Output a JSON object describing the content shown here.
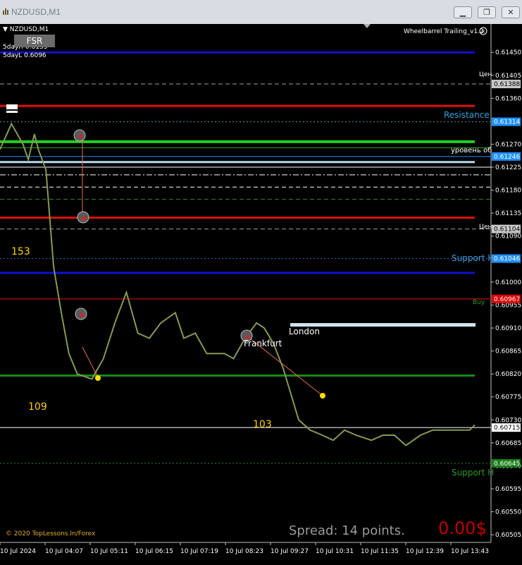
{
  "window": {
    "title": "NZDUSD,M1"
  },
  "chart_header": {
    "symbol": "NZDUSD,M1",
    "five_day_high": "5dayH 0.6153",
    "five_day_low": "5dayL 0.6096",
    "fsr_button": "FSR",
    "indicator_name": "Wheelbarrel Trailing_v1.2"
  },
  "overlay_labels": {
    "resistance": "Resistance",
    "support1": "Support H",
    "support2": "Support H",
    "level_ru": "уровень об",
    "cen1": "Цен",
    "cen2": "Цен",
    "buy": "Buy",
    "london": "London",
    "frankfurt": "Frankfurt",
    "num153": "153",
    "num109": "109",
    "num103": "103",
    "copyright": "© 2020 TopLessons.In/Forex",
    "spread": "Spread: 14 points.",
    "profit": "0.00$"
  },
  "price_axis": {
    "ticks": [
      "0.61450",
      "0.61405",
      "0.61360",
      "0.61270",
      "0.61225",
      "0.61180",
      "0.61135",
      "0.61090",
      "0.61000",
      "0.60955",
      "0.60910",
      "0.60865",
      "0.60820",
      "0.60775",
      "0.60730",
      "0.60685",
      "0.60640",
      "0.60595",
      "0.60550",
      "0.60505"
    ],
    "tags": [
      {
        "text": "0.61388",
        "bg": "#c8c8c8",
        "fg": "#000000"
      },
      {
        "text": "0.61314",
        "bg": "#1e90ff",
        "fg": "#ffffff"
      },
      {
        "text": "0.61246",
        "bg": "#1e90ff",
        "fg": "#ffffff"
      },
      {
        "text": "0.61104",
        "bg": "#c8c8c8",
        "fg": "#000000"
      },
      {
        "text": "0.61046",
        "bg": "#1e90ff",
        "fg": "#ffffff"
      },
      {
        "text": "0.60967",
        "bg": "#e00000",
        "fg": "#ffffff"
      },
      {
        "text": "0.60715",
        "bg": "#ffffff",
        "fg": "#000000"
      },
      {
        "text": "0.60645",
        "bg": "#1a7f1a",
        "fg": "#ffffff"
      }
    ]
  },
  "time_axis": {
    "labels": [
      "10 Jul 2024",
      "10 Jul 04:07",
      "10 Jul 05:11",
      "10 Jul 06:15",
      "10 Jul 07:19",
      "10 Jul 08:23",
      "10 Jul 09:27",
      "10 Jul 10:31",
      "10 Jul 11:35",
      "10 Jul 12:39",
      "10 Jul 13:43"
    ]
  },
  "chart_data": {
    "type": "line",
    "symbol": "NZDUSD,M1",
    "ylim": [
      0.6049,
      0.615
    ],
    "times": [
      "03:30",
      "03:45",
      "04:00",
      "04:07",
      "04:15",
      "04:20",
      "04:25",
      "04:30",
      "04:40",
      "04:50",
      "05:00",
      "05:11",
      "05:30",
      "05:45",
      "06:00",
      "06:15",
      "06:30",
      "06:45",
      "07:00",
      "07:19",
      "07:30",
      "07:45",
      "08:00",
      "08:15",
      "08:23",
      "08:35",
      "08:50",
      "09:05",
      "09:15",
      "09:27",
      "09:40",
      "09:50",
      "10:00",
      "10:15",
      "10:31",
      "10:45",
      "11:00",
      "11:15",
      "11:35",
      "11:50",
      "12:05",
      "12:20",
      "12:39",
      "12:55",
      "13:10",
      "13:25",
      "13:43",
      "13:50"
    ],
    "price": [
      0.6126,
      0.6131,
      0.6127,
      0.6124,
      0.6129,
      0.6126,
      0.6124,
      0.6122,
      0.6103,
      0.6094,
      0.6086,
      0.6082,
      0.6081,
      0.6085,
      0.6092,
      0.6098,
      0.609,
      0.6089,
      0.6092,
      0.6094,
      0.6089,
      0.609,
      0.6086,
      0.6086,
      0.6086,
      0.6085,
      0.6089,
      0.6092,
      0.6091,
      0.6088,
      0.6083,
      0.6078,
      0.6073,
      0.6071,
      0.607,
      0.6069,
      0.6071,
      0.607,
      0.6069,
      0.607,
      0.607,
      0.6068,
      0.607,
      0.6071,
      0.6071,
      0.6071,
      0.6071,
      0.6072
    ]
  },
  "levels": [
    {
      "price": 0.6145,
      "color": "#1010d0",
      "style": "solid",
      "width": 3
    },
    {
      "price": 0.61388,
      "color": "#a0a0a0",
      "style": "dash",
      "width": 1
    },
    {
      "price": 0.61345,
      "color": "#e01010",
      "style": "solid",
      "width": 3
    },
    {
      "price": 0.61314,
      "color": "#4aa0a0",
      "style": "dot",
      "width": 1
    },
    {
      "price": 0.61275,
      "color": "#20d020",
      "style": "solid",
      "width": 4
    },
    {
      "price": 0.61263,
      "color": "#2a9a2a",
      "style": "solid",
      "width": 1
    },
    {
      "price": 0.61246,
      "color": "#1e90ff",
      "style": "solid",
      "width": 1
    },
    {
      "price": 0.61235,
      "color": "#b8d8f0",
      "style": "solid",
      "width": 3
    },
    {
      "price": 0.61225,
      "color": "#ffffff",
      "style": "solid",
      "width": 1
    },
    {
      "price": 0.6121,
      "color": "#ffffff",
      "style": "dashdot",
      "width": 1
    },
    {
      "price": 0.61186,
      "color": "#ffffff",
      "style": "dash",
      "width": 1
    },
    {
      "price": 0.61162,
      "color": "#2a8a2a",
      "style": "dash",
      "width": 1
    },
    {
      "price": 0.61126,
      "color": "#e01010",
      "style": "solid",
      "width": 3
    },
    {
      "price": 0.61104,
      "color": "#a0a0a0",
      "style": "dash",
      "width": 1
    },
    {
      "price": 0.61046,
      "color": "#3a70c0",
      "style": "dot",
      "width": 1
    },
    {
      "price": 0.61018,
      "color": "#1010d0",
      "style": "solid",
      "width": 3
    },
    {
      "price": 0.60967,
      "color": "#e01010",
      "style": "solid",
      "width": 1
    },
    {
      "price": 0.60817,
      "color": "#1a8a1a",
      "style": "solid",
      "width": 3
    },
    {
      "price": 0.60715,
      "color": "#ffffff",
      "style": "solid",
      "width": 1
    },
    {
      "price": 0.60645,
      "color": "#2a8a2a",
      "style": "dot",
      "width": 1
    }
  ]
}
